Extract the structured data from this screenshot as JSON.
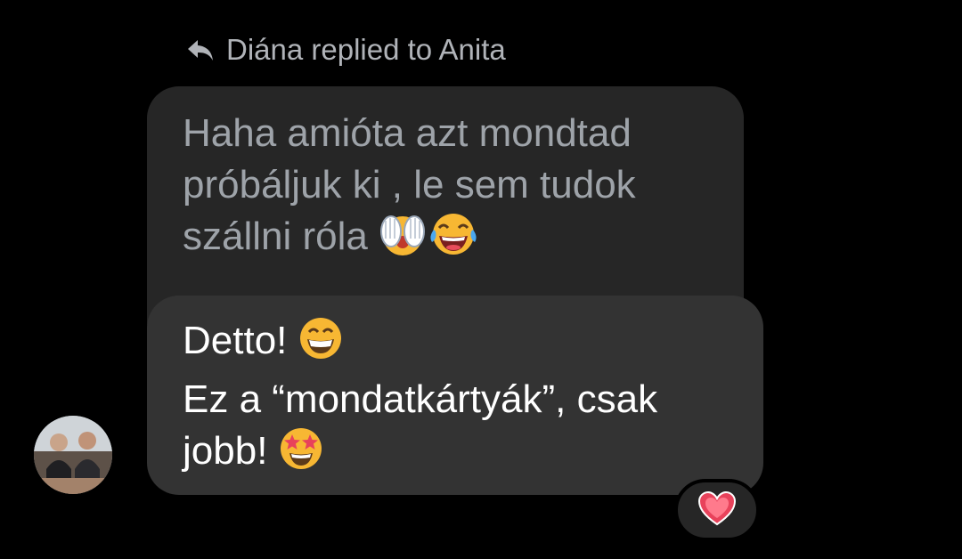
{
  "reply_header": {
    "text": "Diána replied to Anita",
    "icon": "reply-arrow-icon"
  },
  "quoted_message": {
    "text": "Haha amióta azt mondtad\npróbáljuk ki , le sem tudok\nszállni róla",
    "emojis": [
      "face-with-hands-over-eyes-emoji",
      "tears-of-joy-emoji"
    ]
  },
  "reply_message": {
    "line1": "Detto!",
    "line2": "Ez a “mondatkártyák”, csak\njobb!",
    "emojis": [
      "grinning-face-emoji",
      "star-struck-emoji"
    ]
  },
  "reaction": {
    "icon": "heart-icon",
    "color": "#e8425b"
  },
  "colors": {
    "background": "#000000",
    "quoted_bubble": "#262626",
    "reply_bubble": "#333333",
    "secondary_text": "#b0b3b8"
  }
}
